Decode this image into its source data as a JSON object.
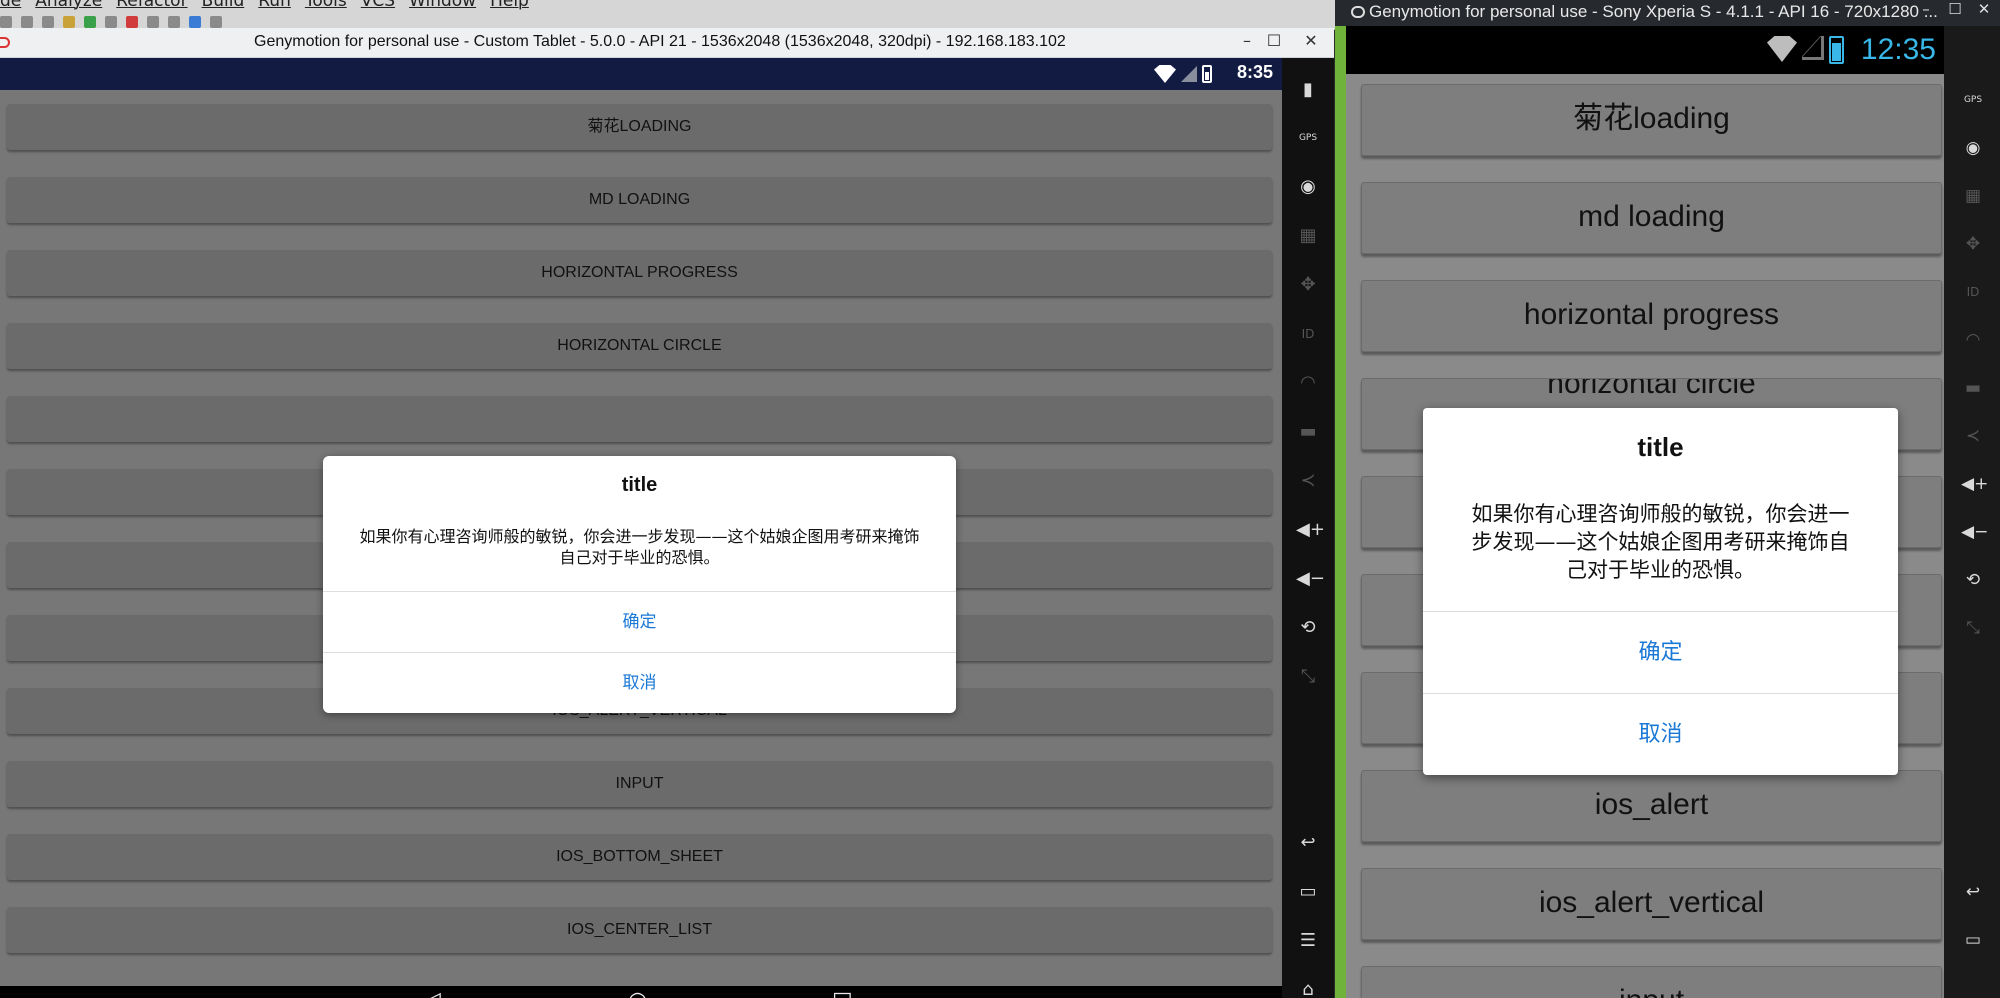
{
  "ide": {
    "menu": [
      "de",
      "Analyze",
      "Refactor",
      "Build",
      "Run",
      "Tools",
      "VCS",
      "Window",
      "Help"
    ]
  },
  "left": {
    "window_title": "Genymotion for personal use - Custom Tablet - 5.0.0 - API 21 - 1536x2048 (1536x2048, 320dpi) - 192.168.183.102",
    "window_controls": {
      "minimize": "–",
      "maximize": "☐",
      "close": "✕"
    },
    "status_time": "8:35",
    "buttons": [
      "菊花LOADING",
      "MD LOADING",
      "HORIZONTAL PROGRESS",
      "HORIZONTAL CIRCLE",
      "IOS_ALERT_VERTICAL",
      "INPUT",
      "IOS_BOTTOM_SHEET",
      "IOS_CENTER_LIST"
    ],
    "dialog": {
      "title": "title",
      "message": "如果你有心理咨询师般的敏锐，你会进一步发现——这个姑娘企图用考研来掩饰自己对于毕业的恐惧。",
      "confirm": "确定",
      "cancel": "取消"
    },
    "side_icons": [
      "battery-icon",
      "gps-icon",
      "webcam-icon",
      "movie-icon",
      "dpad-icon",
      "id-icon",
      "rss-icon",
      "sms-icon",
      "share-icon",
      "volume-up-icon",
      "volume-down-icon",
      "rotate-icon",
      "scale-icon",
      "back-icon",
      "recent-apps-icon",
      "menu-icon",
      "home-icon",
      "power-icon"
    ]
  },
  "right": {
    "window_title": "Genymotion for personal use - Sony Xperia S - 4.1.1 - API 16 - 720x1280 ...",
    "window_controls": {
      "minimize": "–",
      "maximize": "☐",
      "close": "✕"
    },
    "status_time": "12:35",
    "buttons": [
      "菊花loading",
      "md loading",
      "horizontal progress",
      "horizontal circle",
      "ios_alert",
      "ios_alert_vertical",
      "input"
    ],
    "dialog": {
      "title": "title",
      "message": "如果你有心理咨询师般的敏锐，你会进一步发现——这个姑娘企图用考研来掩饰自己对于毕业的恐惧。",
      "confirm": "确定",
      "cancel": "取消"
    },
    "side_icons": [
      "gps-icon",
      "webcam-icon",
      "movie-icon",
      "dpad-icon",
      "id-icon",
      "rss-icon",
      "sms-icon",
      "share-icon",
      "volume-up-icon",
      "volume-down-icon",
      "rotate-icon",
      "scale-icon",
      "back-icon",
      "recent-apps-icon"
    ]
  }
}
